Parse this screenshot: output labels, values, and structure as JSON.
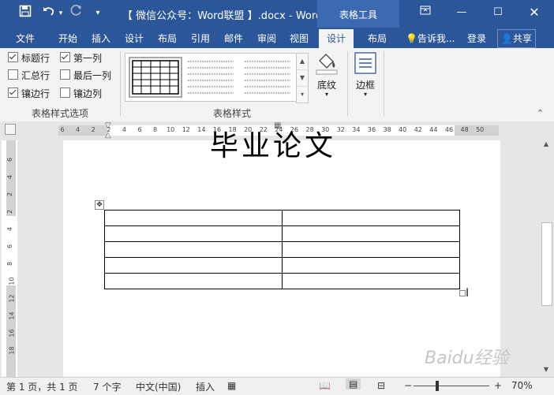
{
  "window": {
    "title": "【 微信公众号：Word联盟 】.docx - Word",
    "context_tool": "表格工具",
    "undo_icon": "undo-icon",
    "redo_icon": "redo-icon",
    "save_icon": "save-icon"
  },
  "tabs": [
    "文件",
    "开始",
    "插入",
    "设计",
    "布局",
    "引用",
    "邮件",
    "审阅",
    "视图",
    "设计",
    "布局"
  ],
  "active_tab_index": 9,
  "tellme": "告诉我...",
  "login": "登录",
  "share": "共享",
  "ribbon": {
    "style_options": {
      "label": "表格样式选项",
      "items": [
        {
          "label": "标题行",
          "checked": true
        },
        {
          "label": "第一列",
          "checked": true
        },
        {
          "label": "汇总行",
          "checked": false
        },
        {
          "label": "最后一列",
          "checked": false
        },
        {
          "label": "镶边行",
          "checked": true
        },
        {
          "label": "镶边列",
          "checked": false
        }
      ]
    },
    "table_styles_label": "表格样式",
    "shading_label": "底纹",
    "borders_label": "边框"
  },
  "ruler": {
    "h_ticks": [
      "6",
      "4",
      "2",
      "2",
      "4",
      "6",
      "8",
      "10",
      "12",
      "14",
      "16",
      "18",
      "20",
      "22",
      "24",
      "26",
      "28",
      "30",
      "32",
      "34",
      "36",
      "38",
      "40",
      "42",
      "44",
      "46",
      "48",
      "50"
    ],
    "v_ticks": [
      "6",
      "4",
      "2",
      "2",
      "4",
      "6",
      "8",
      "10",
      "12",
      "14",
      "16",
      "18"
    ]
  },
  "document": {
    "heading_fragment": "毕业论文",
    "table_rows": 5,
    "table_cols": 2
  },
  "status": {
    "page": "第 1 页，共 1 页",
    "words": "7 个字",
    "language": "中文(中国)",
    "mode": "插入",
    "zoom": "70%"
  },
  "watermark": "Baidu经验"
}
